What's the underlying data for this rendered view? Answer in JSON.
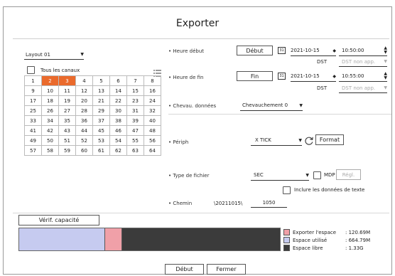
{
  "title": "Exporter",
  "left": {
    "layout_value": "Layout 01",
    "all_channels_label": "Tous les canaux",
    "channels": [
      [
        "1",
        "2",
        "3",
        "4",
        "5",
        "6",
        "7",
        "8"
      ],
      [
        "9",
        "10",
        "11",
        "12",
        "13",
        "14",
        "15",
        "16"
      ],
      [
        "17",
        "18",
        "19",
        "20",
        "21",
        "22",
        "23",
        "24"
      ],
      [
        "25",
        "26",
        "27",
        "28",
        "29",
        "30",
        "31",
        "32"
      ],
      [
        "33",
        "34",
        "35",
        "36",
        "37",
        "38",
        "39",
        "40"
      ],
      [
        "41",
        "42",
        "43",
        "44",
        "45",
        "46",
        "47",
        "48"
      ],
      [
        "49",
        "50",
        "51",
        "52",
        "53",
        "54",
        "55",
        "56"
      ],
      [
        "57",
        "58",
        "59",
        "60",
        "61",
        "62",
        "63",
        "64"
      ]
    ],
    "selected_channels": [
      "2",
      "3"
    ],
    "selected_color": "#ea6a2c"
  },
  "start": {
    "label": "Heure début",
    "button": "Début",
    "calendar_icon_text": "31",
    "date": "2021-10-15",
    "time": "10:50:00",
    "dst_label": "DST",
    "dst_value": "DST non app."
  },
  "end": {
    "label": "Heure de fin",
    "button": "Fin",
    "calendar_icon_text": "31",
    "date": "2021-10-15",
    "time": "10:55:00",
    "dst_label": "DST",
    "dst_value": "DST non app."
  },
  "overlap": {
    "label": "Chevau. données",
    "value": "Chevauchement 0"
  },
  "device": {
    "label": "Périph",
    "value": "X TICK",
    "format_button": "Format"
  },
  "filetype": {
    "label": "Type de fichier",
    "value": "SEC",
    "mdp_label": "MDP",
    "regl_button": "Régl.",
    "include_text_label": "Inclure les données de texte"
  },
  "path": {
    "label": "Chemin",
    "prefix": "\\20211015\\",
    "value": "1050"
  },
  "capacity": {
    "check_button": "Vérif. capacité",
    "used_fraction": 0.33,
    "export_fraction": 0.065,
    "legend": [
      {
        "label": "Exporter l'espace",
        "value": ": 120.69M",
        "color": "#f0a0a8"
      },
      {
        "label": "Espace utilisé",
        "value": ": 664.79M",
        "color": "#c6cbf0"
      },
      {
        "label": "Espace libre",
        "value": ": 1.33G",
        "color": "#3b3b3b"
      }
    ]
  },
  "footer": {
    "start_button": "Début",
    "close_button": "Fermer"
  }
}
